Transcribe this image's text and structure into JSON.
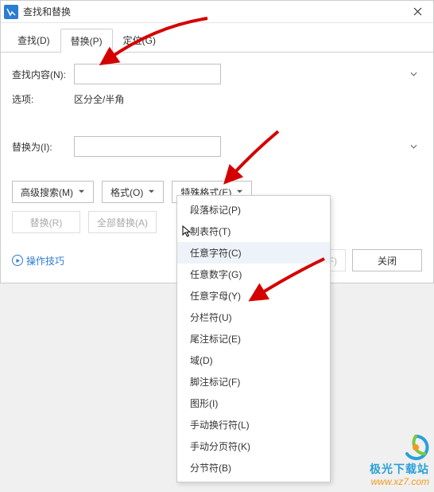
{
  "window": {
    "title": "查找和替换"
  },
  "tabs": [
    {
      "label": "查找(D)"
    },
    {
      "label": "替换(P)"
    },
    {
      "label": "定位(G)"
    }
  ],
  "fields": {
    "find_label": "查找内容(N):",
    "find_value": "",
    "options_label": "选项:",
    "options_value": "区分全/半角",
    "replace_label": "替换为(I):",
    "replace_value": ""
  },
  "buttons": {
    "advanced": "高级搜索(M)",
    "format": "格式(O)",
    "special": "特殊格式(E)",
    "replace": "替换(R)",
    "replace_all": "全部替换(A)",
    "find_next": "查找下一处(F)",
    "close": "关闭"
  },
  "tips": "操作技巧",
  "menu": [
    "段落标记(P)",
    "制表符(T)",
    "任意字符(C)",
    "任意数字(G)",
    "任意字母(Y)",
    "分栏符(U)",
    "尾注标记(E)",
    "域(D)",
    "脚注标记(F)",
    "图形(I)",
    "手动换行符(L)",
    "手动分页符(K)",
    "分节符(B)"
  ],
  "watermark": {
    "name": "极光下载站",
    "url": "www.xz7.com"
  }
}
